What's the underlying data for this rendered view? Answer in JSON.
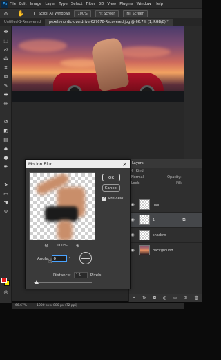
{
  "menu": [
    "File",
    "Edit",
    "Image",
    "Layer",
    "Type",
    "Select",
    "Filter",
    "3D",
    "View",
    "Plugins",
    "Window",
    "Help"
  ],
  "app_logo": "Ps",
  "options_bar": {
    "scroll_all_windows": "Scroll All Windows",
    "zoom_100": "100%",
    "fit_screen": "Fit Screen",
    "fill_screen": "Fill Screen"
  },
  "tabs": [
    {
      "label": "Untitled-1-Recovered",
      "active": false
    },
    {
      "label": "pexels-nordic-overdrive-627678-Recovered.jpg @ 66.7% (1, RGB/8) *",
      "active": true
    }
  ],
  "status_bar": {
    "zoom": "66.67%",
    "doc_size": "1000 px x 880 px (72 ppi)"
  },
  "layers_panel": {
    "title": "Layers",
    "filter_label": "Kind",
    "blend_mode": "Normal",
    "opacity_label": "Opacity:",
    "lock_label": "Lock:",
    "fill_label": "Fill:",
    "layers": [
      {
        "name": "man",
        "selected": false
      },
      {
        "name": "1",
        "selected": true
      },
      {
        "name": "shadow",
        "selected": false
      },
      {
        "name": "background",
        "selected": false
      }
    ]
  },
  "dialog": {
    "title": "Motion Blur",
    "ok_label": "OK",
    "cancel_label": "Cancel",
    "preview_label": "Preview",
    "preview_checked": true,
    "zoom_level": "100%",
    "angle_label": "Angle:",
    "angle_value": "0",
    "angle_unit": "°",
    "distance_label": "Distance:",
    "distance_value": "15",
    "distance_unit": "Pixels"
  }
}
